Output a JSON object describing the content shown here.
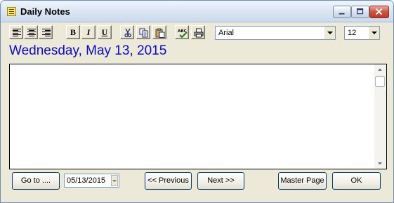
{
  "window": {
    "title": "Daily Notes",
    "controls": {
      "minimize_icon": "minimize-icon",
      "maximize_icon": "maximize-icon",
      "close_icon": "close-icon"
    }
  },
  "toolbar": {
    "buttons": [
      {
        "name": "align-left",
        "icon": "align-left-icon"
      },
      {
        "name": "align-center",
        "icon": "align-center-icon"
      },
      {
        "name": "align-right",
        "icon": "align-right-icon"
      },
      {
        "name": "bold",
        "label": "B",
        "icon": "bold-icon"
      },
      {
        "name": "italic",
        "label": "I",
        "icon": "italic-icon"
      },
      {
        "name": "underline",
        "label": "U",
        "icon": "underline-icon"
      },
      {
        "name": "cut",
        "icon": "scissors-icon"
      },
      {
        "name": "copy",
        "icon": "copy-icon"
      },
      {
        "name": "paste",
        "icon": "paste-icon"
      },
      {
        "name": "spell-check",
        "label": "ABC",
        "icon": "spellcheck-icon"
      },
      {
        "name": "print",
        "icon": "printer-icon"
      }
    ],
    "font_family": "Arial",
    "font_size": "12"
  },
  "date_heading": "Wednesday, May 13, 2015",
  "editor": {
    "content": ""
  },
  "footer": {
    "goto_label": "Go to ....",
    "date_value": "05/13/2015",
    "previous_label": "<< Previous",
    "next_label": "Next >>",
    "master_page_label": "Master Page",
    "ok_label": "OK"
  },
  "colors": {
    "heading_blue": "#0a0ac8",
    "window_face": "#ece9d8",
    "button_border": "#003c74"
  }
}
